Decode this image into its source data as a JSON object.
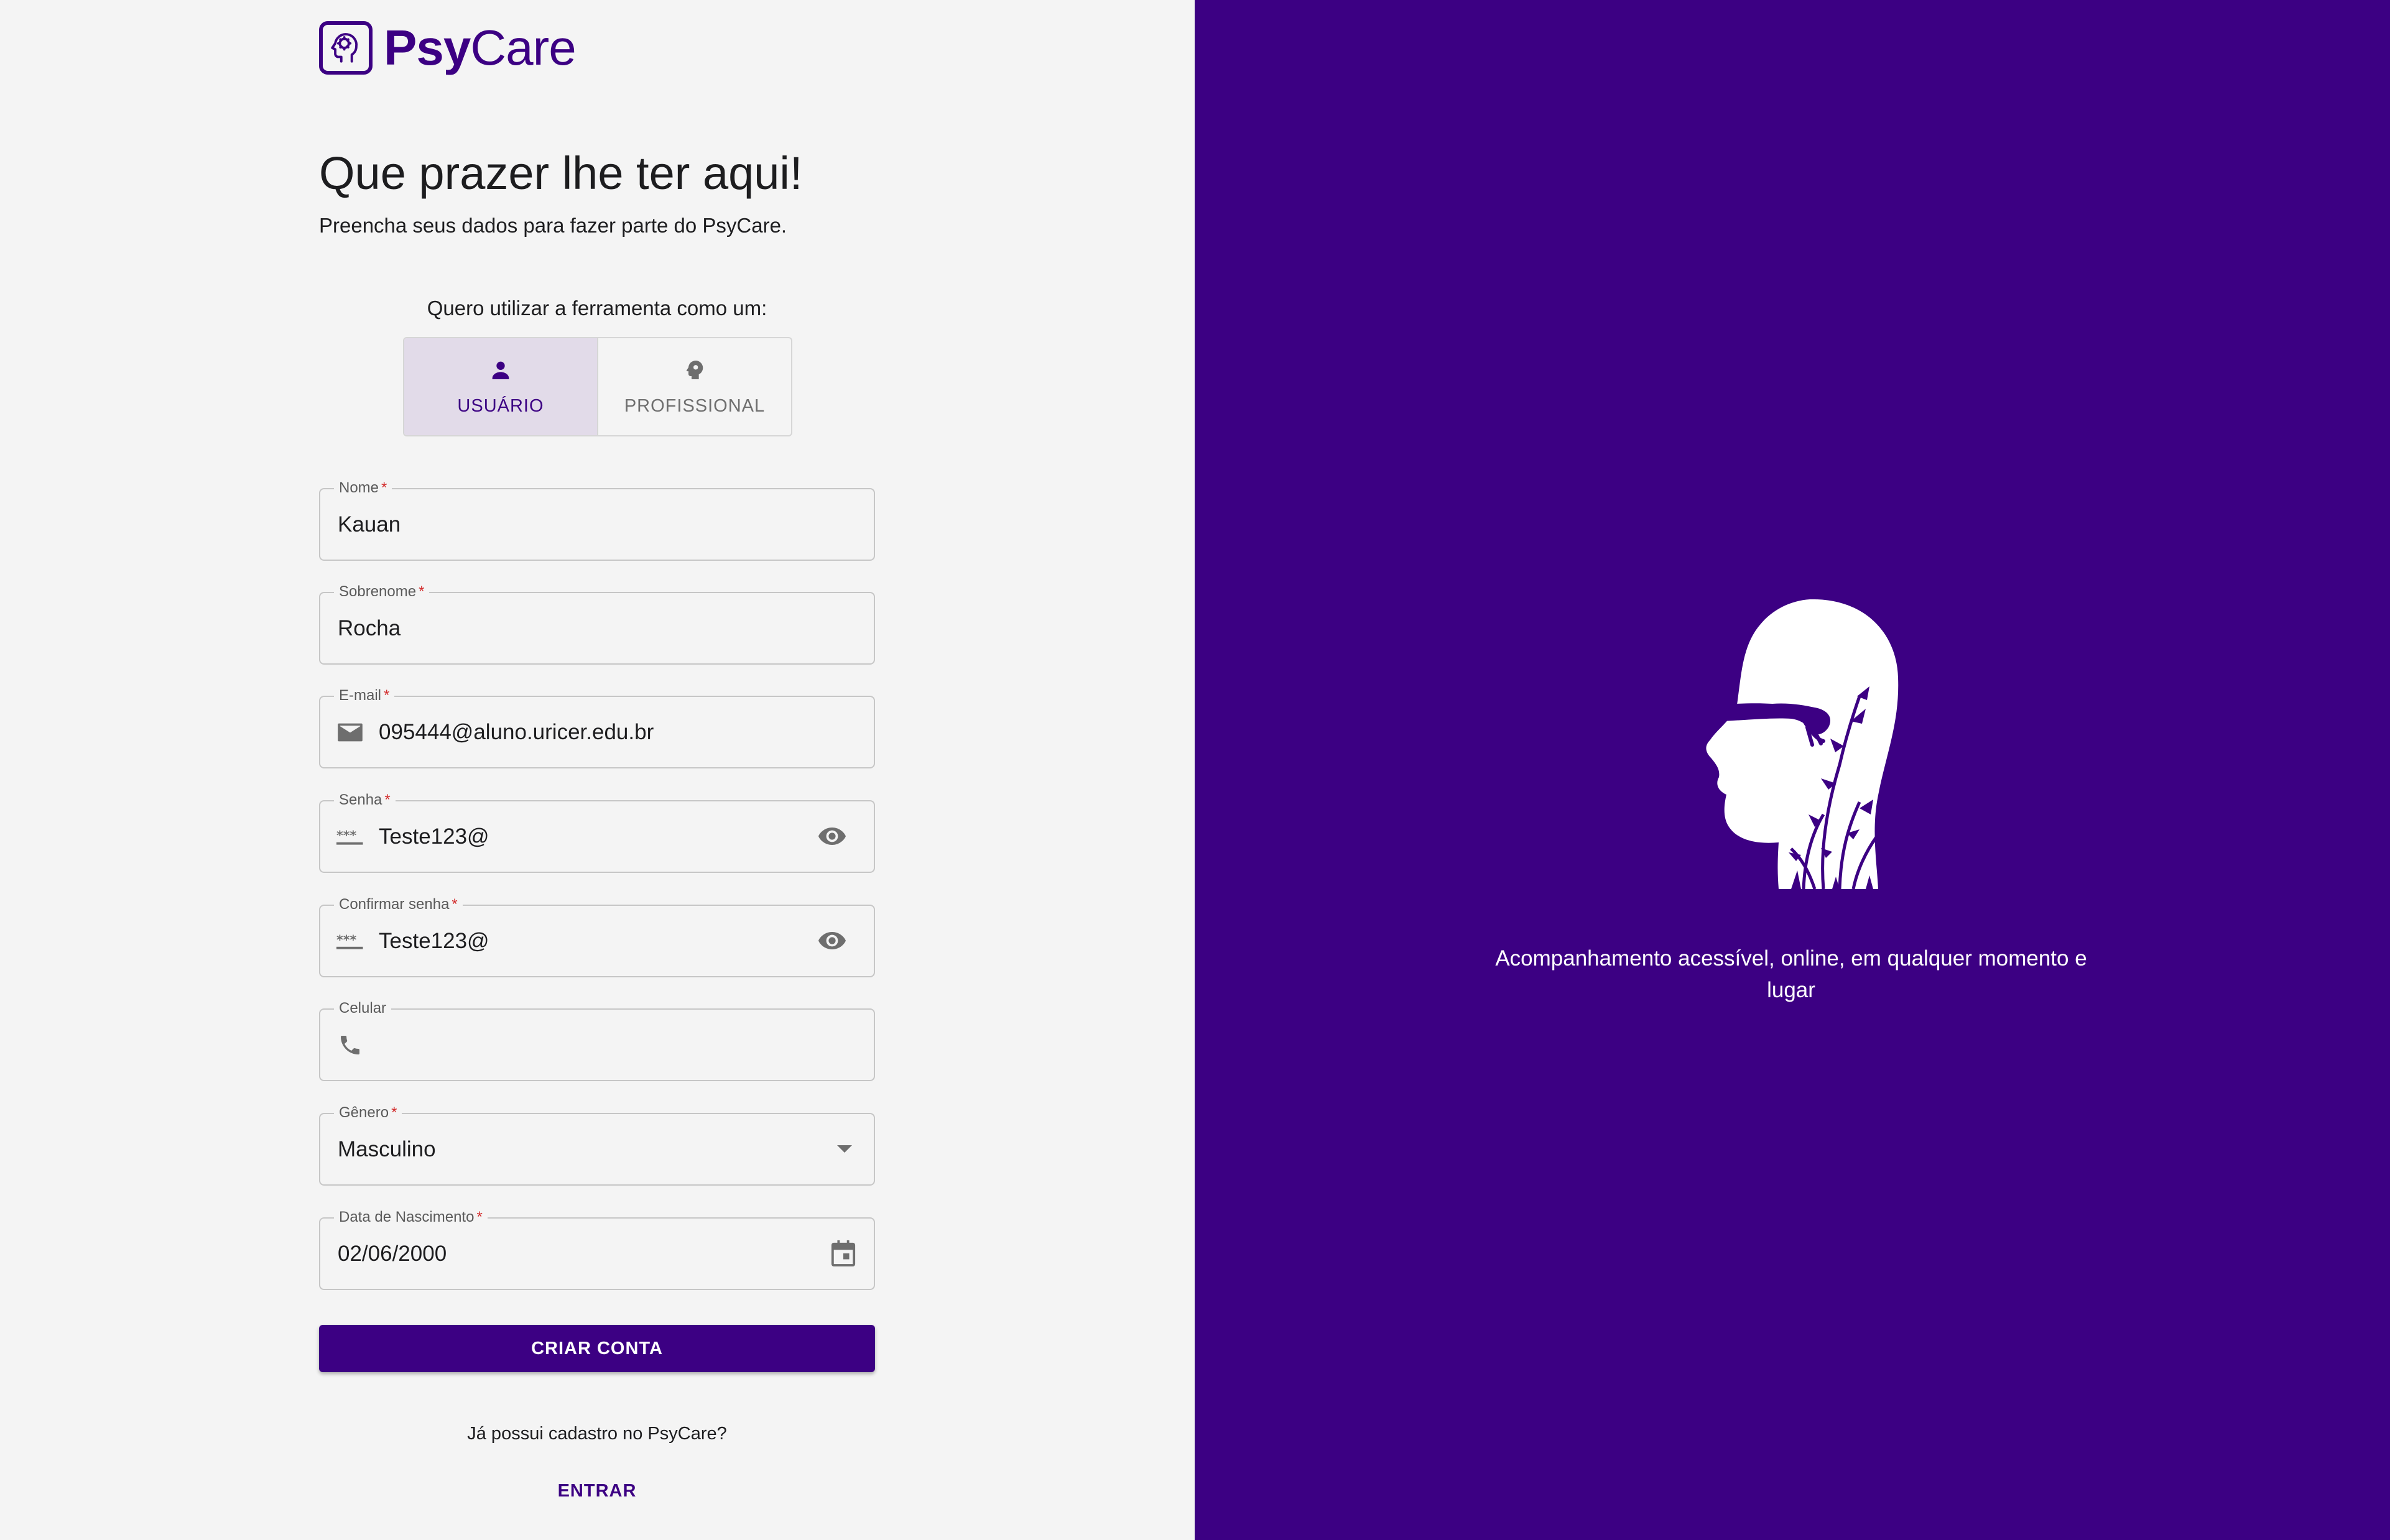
{
  "brand": {
    "name_bold": "Psy",
    "name_regular": "Care"
  },
  "heading": "Que prazer lhe ter aqui!",
  "subheading": "Preencha seus dados para fazer parte do PsyCare.",
  "role_selector": {
    "label": "Quero utilizar a ferramenta como um:",
    "options": [
      {
        "label": "USUÁRIO",
        "icon": "person-icon",
        "selected": true
      },
      {
        "label": "PROFISSIONAL",
        "icon": "psychology-icon",
        "selected": false
      }
    ]
  },
  "form": {
    "required_mark": "*",
    "fields": [
      {
        "label": "Nome",
        "value": "Kauan"
      },
      {
        "label": "Sobrenome",
        "value": "Rocha"
      },
      {
        "label": "E-mail",
        "value": "095444@aluno.uricer.edu.br",
        "icon": "mail-icon"
      },
      {
        "label": "Senha",
        "value": "Teste123@",
        "icon": "password-icon",
        "end_icon": "eye-icon"
      },
      {
        "label": "Confirmar senha",
        "value": "Teste123@",
        "icon": "password-icon",
        "end_icon": "eye-icon"
      },
      {
        "label": "Celular",
        "value": "",
        "icon": "phone-icon"
      },
      {
        "label": "Gênero",
        "value": "Masculino",
        "end_icon": "dropdown-arrow-icon"
      },
      {
        "label": "Data de Nascimento",
        "value": "02/06/2000",
        "end_icon": "calendar-icon"
      }
    ],
    "submit_label": "CRIAR CONTA"
  },
  "login_prompt": {
    "question": "Já possui cadastro no PsyCare?",
    "link_label": "ENTRAR"
  },
  "hero": {
    "tagline": "Acompanhamento acessível, online, em qualquer momento e lugar"
  },
  "colors": {
    "brand": "#3c0083",
    "background": "#f4f4f4",
    "toggle_selected": "#e2dbe9",
    "required": "#d32f2f"
  }
}
